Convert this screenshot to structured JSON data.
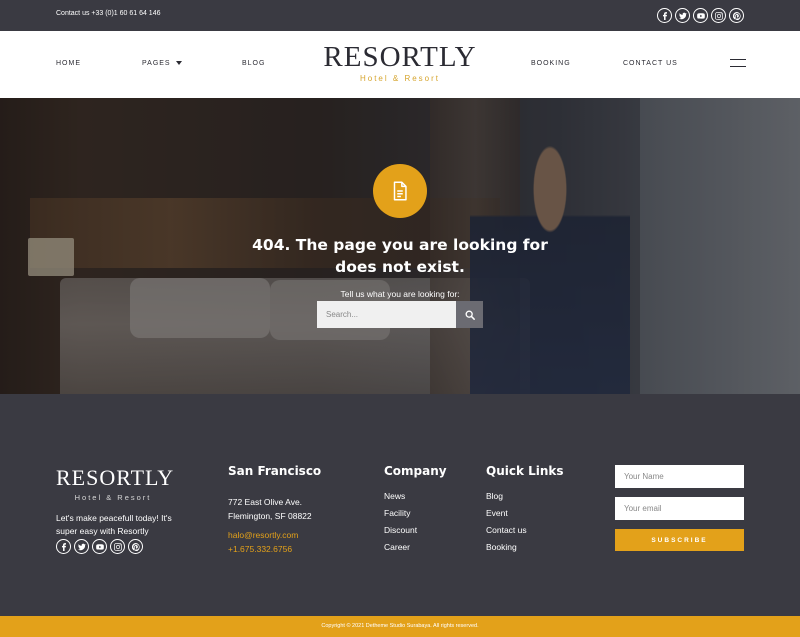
{
  "topbar": {
    "contact": "Contact us +33 (0)1 60 61 64 146",
    "social_icons": [
      "facebook-icon",
      "twitter-icon",
      "youtube-icon",
      "instagram-icon",
      "pinterest-icon"
    ]
  },
  "header": {
    "nav": {
      "home": "HOME",
      "pages": "PAGES",
      "blog": "BLOG",
      "booking": "BOOKING",
      "contact": "CONTACT US"
    },
    "logo": {
      "name": "RESORTLY",
      "sub": "Hotel & Resort"
    }
  },
  "hero": {
    "title_line1": "404. The page you are looking for",
    "title_line2": "does not exist.",
    "search_label": "Tell us what you are looking for:",
    "search_placeholder": "Search..."
  },
  "footer": {
    "logo": {
      "name": "RESORTLY",
      "sub": "Hotel & Resort"
    },
    "tagline_line1": "Let's make peacefull today! It's",
    "tagline_line2": "super easy with Resortly",
    "sf": {
      "title": "San Francisco",
      "address_line1": "772 East Olive Ave.",
      "address_line2": "Flemington, SF 08822",
      "email": "halo@resortly.com",
      "phone": "+1.675.332.6756"
    },
    "company": {
      "title": "Company",
      "links": [
        "News",
        "Facility",
        "Discount",
        "Career"
      ]
    },
    "quick": {
      "title": "Quick Links",
      "links": [
        "Blog",
        "Event",
        "Contact us",
        "Booking"
      ]
    },
    "form": {
      "name_placeholder": "Your Name",
      "email_placeholder": "Your email",
      "subscribe": "SUBSCRIBE"
    },
    "copyright": "Copyright © 2021 Detheme Studio Surabaya. All rights reserved."
  },
  "colors": {
    "accent": "#e3a11a",
    "dark": "#3a3a42"
  }
}
